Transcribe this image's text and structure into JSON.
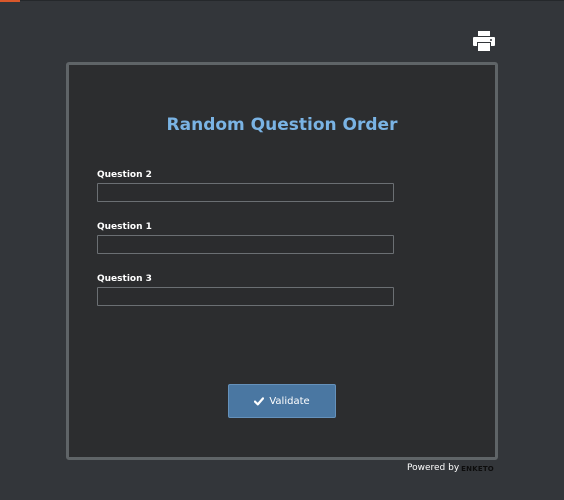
{
  "form": {
    "title": "Random Question Order",
    "questions": [
      {
        "label": "Question 2",
        "value": ""
      },
      {
        "label": "Question 1",
        "value": ""
      },
      {
        "label": "Question 3",
        "value": ""
      }
    ],
    "validate_label": "Validate"
  },
  "footer": {
    "powered_by": "Powered by",
    "logo_text": "ENKETO"
  },
  "icons": {
    "print": "print-icon",
    "check": "check-icon"
  },
  "colors": {
    "page_background": "#33363a",
    "panel_background": "#2c2d2f",
    "panel_border": "#5f6467",
    "title": "#7ab3e4",
    "button": "#4a77a2",
    "accent": "#d9582b"
  }
}
